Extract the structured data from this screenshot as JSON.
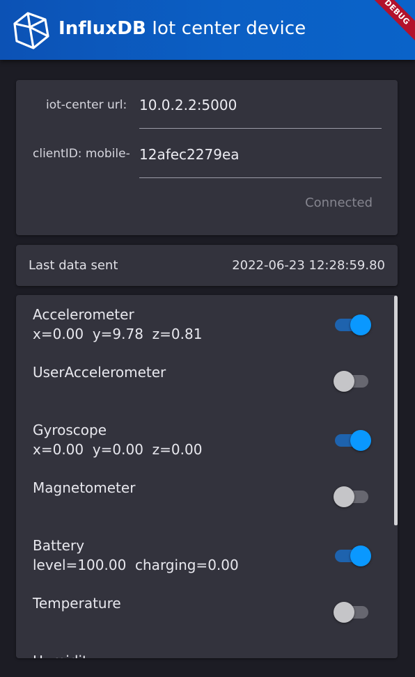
{
  "app": {
    "brand": "InfluxDB",
    "title_rest": " Iot center device",
    "debug_banner": "DEBUG",
    "logo_icon": "influxdb-cube-icon"
  },
  "connection": {
    "url_label": "iot-center url:",
    "url_value": "10.0.2.2:5000",
    "client_label": "clientID: mobile-",
    "client_value": "12afec2279ea",
    "status": "Connected"
  },
  "last_sent": {
    "label": "Last data sent",
    "value": "2022-06-23 12:28:59.80"
  },
  "sensors": [
    {
      "name": "Accelerometer",
      "values": "x=0.00  y=9.78  z=0.81",
      "enabled": true
    },
    {
      "name": "UserAccelerometer",
      "values": "",
      "enabled": false
    },
    {
      "name": "Gyroscope",
      "values": "x=0.00  y=0.00  z=0.00",
      "enabled": true
    },
    {
      "name": "Magnetometer",
      "values": "",
      "enabled": false
    },
    {
      "name": "Battery",
      "values": "level=100.00  charging=0.00",
      "enabled": true
    },
    {
      "name": "Temperature",
      "values": "",
      "enabled": false
    },
    {
      "name": "Humidity",
      "values": "",
      "enabled": false
    }
  ],
  "colors": {
    "appbar": "#0b5fc4",
    "background": "#1c1c24",
    "card": "#33333d",
    "switch_on": "#0a98ff",
    "switch_off": "#c5c5c8",
    "status_text": "#85858f"
  }
}
